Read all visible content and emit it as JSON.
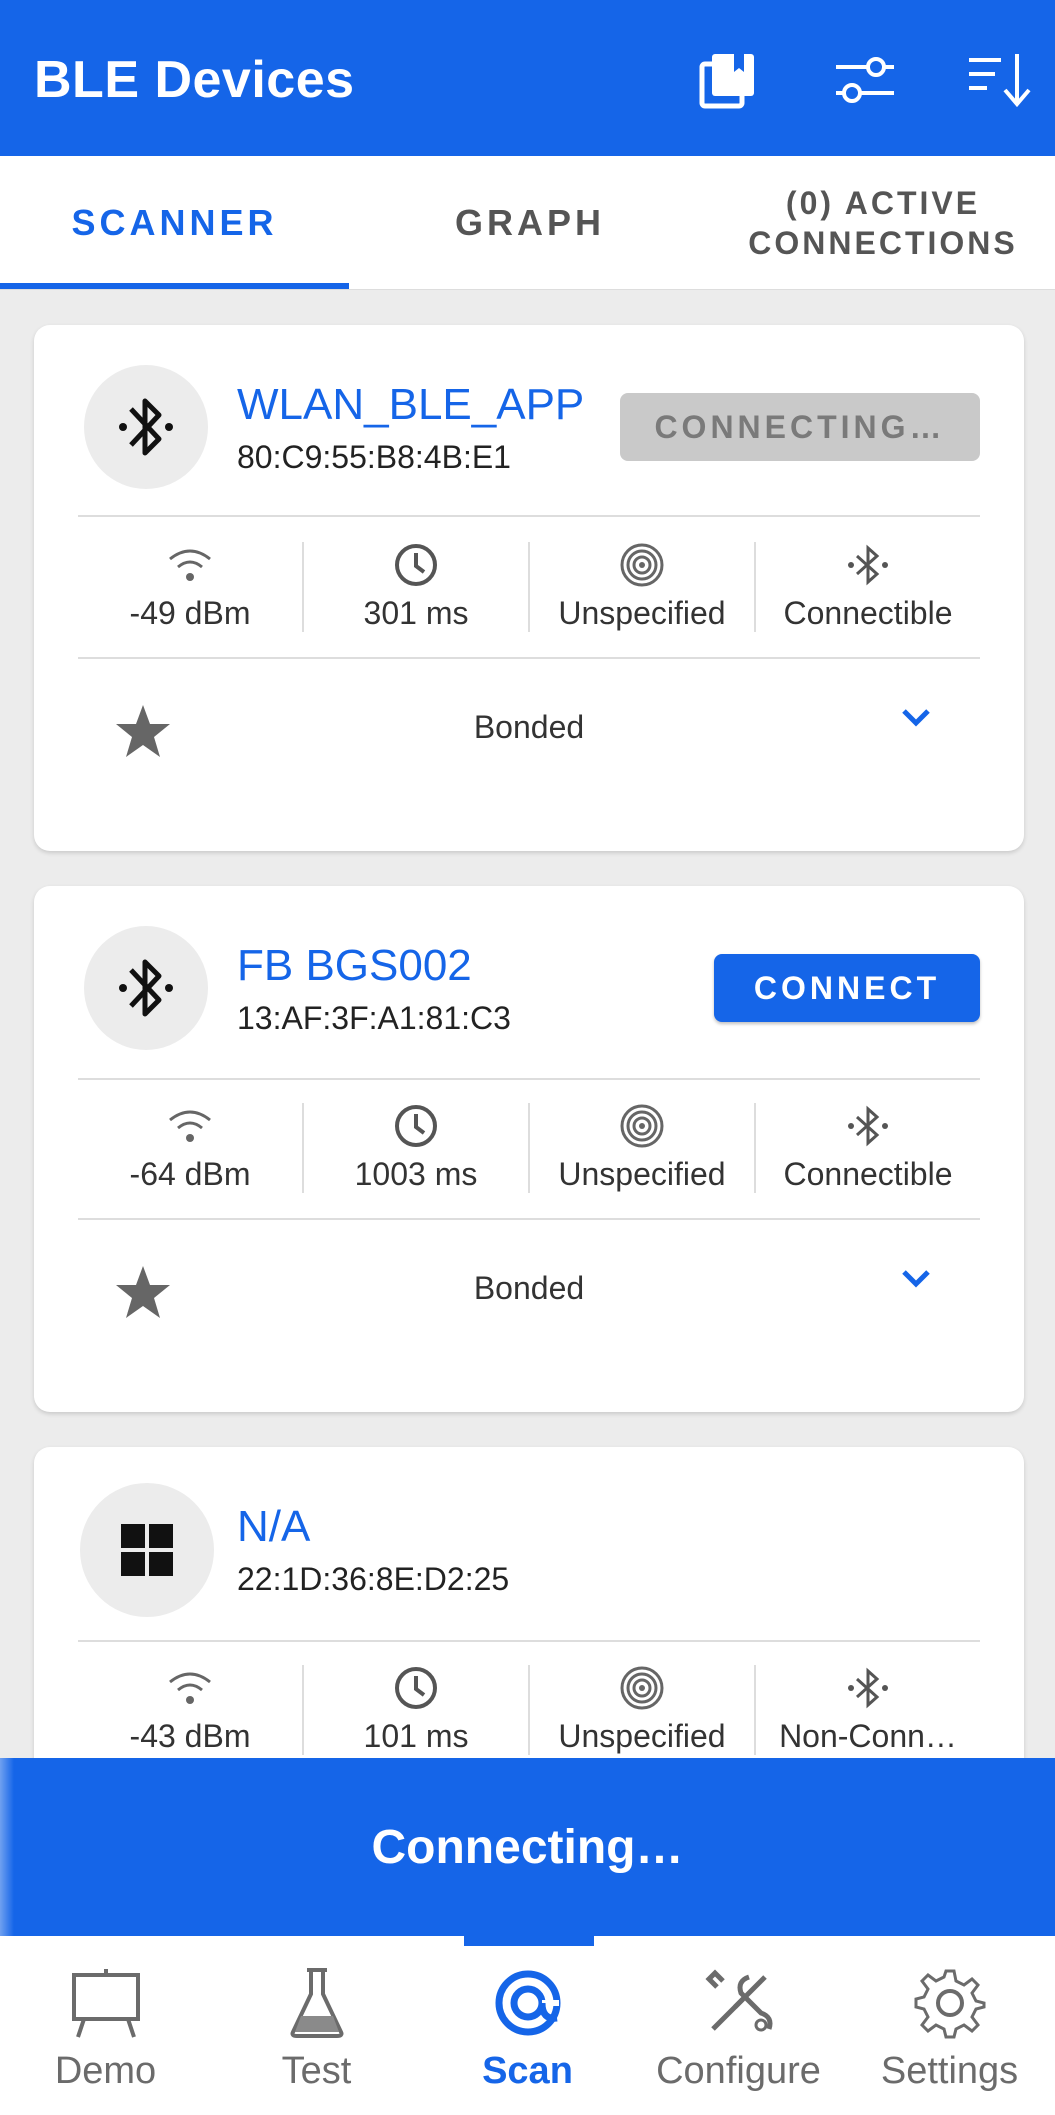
{
  "appbar": {
    "title": "BLE Devices",
    "actions": [
      "bookmarks-icon",
      "filter-icon",
      "sort-icon"
    ]
  },
  "tabs": [
    {
      "label": "SCANNER",
      "active": true
    },
    {
      "label": "GRAPH",
      "active": false
    },
    {
      "label_line1": "(0) ACTIVE",
      "label_line2": "CONNECTIONS",
      "active": false
    }
  ],
  "devices": [
    {
      "name": "WLAN_BLE_APP",
      "address": "80:C9:55:B8:4B:E1",
      "icon": "bluetooth-icon",
      "button": "CONNECTING…",
      "button_state": "disabled",
      "rssi": "-49 dBm",
      "interval": "301 ms",
      "beacon": "Unspecified",
      "connectibility": "Connectible",
      "bond_status": "Bonded"
    },
    {
      "name": "FB BGS002",
      "address": "13:AF:3F:A1:81:C3",
      "icon": "bluetooth-icon",
      "button": "CONNECT",
      "button_state": "enabled",
      "rssi": "-64 dBm",
      "interval": "1003 ms",
      "beacon": "Unspecified",
      "connectibility": "Connectible",
      "bond_status": "Bonded"
    },
    {
      "name": "N/A",
      "address": "22:1D:36:8E:D2:25",
      "icon": "windows-icon",
      "rssi": "-43 dBm",
      "interval": "101 ms",
      "beacon": "Unspecified",
      "connectibility": "Non-Conn…"
    }
  ],
  "banner": {
    "text": "Connecting…"
  },
  "bottom_nav": [
    {
      "label": "Demo",
      "icon": "presentation-board-icon",
      "active": false
    },
    {
      "label": "Test",
      "icon": "flask-icon",
      "active": false
    },
    {
      "label": "Scan",
      "icon": "scan-target-icon",
      "active": true
    },
    {
      "label": "Configure",
      "icon": "tools-icon",
      "active": false
    },
    {
      "label": "Settings",
      "icon": "gear-icon",
      "active": false
    }
  ],
  "colors": {
    "accent": "#1565e8",
    "background": "#ececec",
    "disabled_button": "#c9c9c9"
  }
}
